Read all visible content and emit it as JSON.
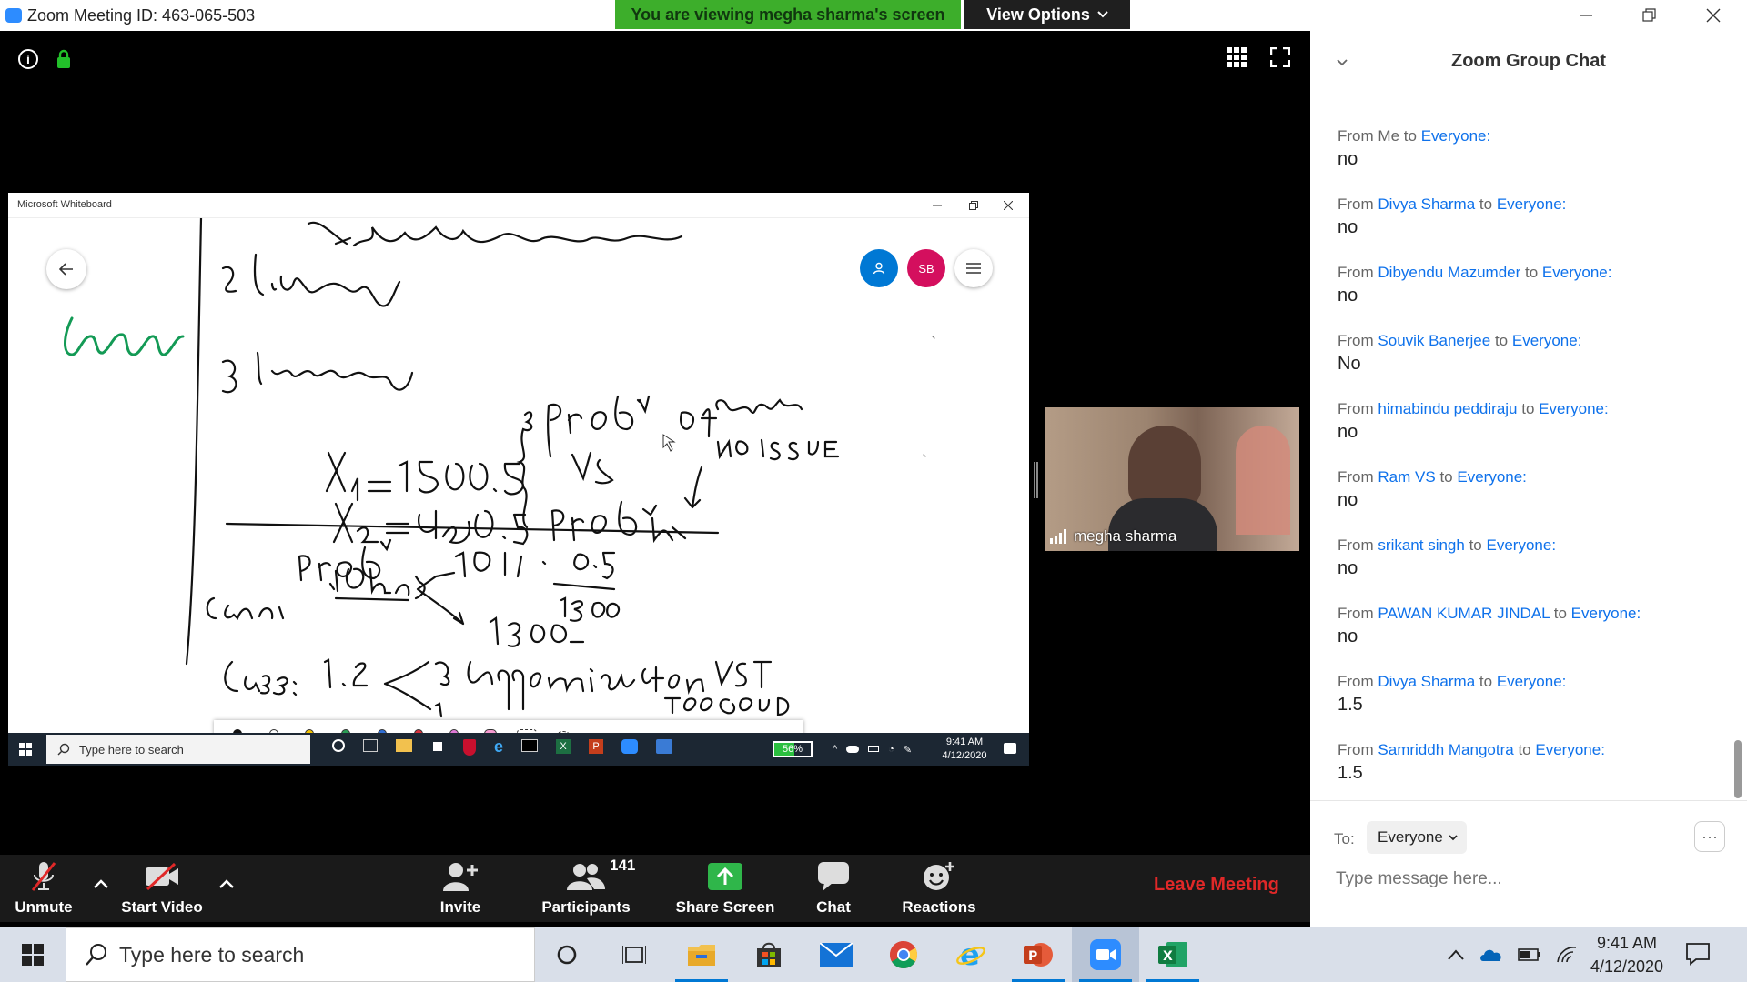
{
  "window": {
    "title": "Zoom Meeting ID: 463-065-503"
  },
  "banner": {
    "viewing_text": "You are viewing megha sharma's screen",
    "view_options_label": "View Options"
  },
  "whiteboard": {
    "title": "Microsoft Whiteboard",
    "user_initials": "SB",
    "taskbar": {
      "search_placeholder": "Type here to search",
      "battery": "56%",
      "time": "9:41 AM",
      "date": "4/12/2020"
    }
  },
  "video": {
    "participant_name": "megha sharma"
  },
  "toolbar": {
    "unmute_label": "Unmute",
    "start_video_label": "Start Video",
    "invite_label": "Invite",
    "participants_label": "Participants",
    "participants_count": "141",
    "share_screen_label": "Share Screen",
    "chat_label": "Chat",
    "reactions_label": "Reactions",
    "leave_label": "Leave Meeting"
  },
  "chat": {
    "title": "Zoom Group Chat",
    "messages": [
      {
        "from_prefix": "From",
        "sender": "Me",
        "to_word": "to",
        "recipient": "Everyone:",
        "text": "no"
      },
      {
        "from_prefix": "From",
        "sender": "Divya Sharma",
        "to_word": "to",
        "recipient": "Everyone:",
        "text": "no"
      },
      {
        "from_prefix": "From",
        "sender": "Dibyendu Mazumder",
        "to_word": "to",
        "recipient": "Everyone:",
        "text": "no"
      },
      {
        "from_prefix": "From",
        "sender": "Souvik Banerjee",
        "to_word": "to",
        "recipient": "Everyone:",
        "text": "No"
      },
      {
        "from_prefix": "From",
        "sender": "himabindu peddiraju",
        "to_word": "to",
        "recipient": "Everyone:",
        "text": "no"
      },
      {
        "from_prefix": "From",
        "sender": "Ram VS",
        "to_word": "to",
        "recipient": "Everyone:",
        "text": "no"
      },
      {
        "from_prefix": "From",
        "sender": "srikant singh",
        "to_word": "to",
        "recipient": "Everyone:",
        "text": "no"
      },
      {
        "from_prefix": "From",
        "sender": "PAWAN KUMAR JINDAL",
        "to_word": "to",
        "recipient": "Everyone:",
        "text": "no"
      },
      {
        "from_prefix": "From",
        "sender": "Divya Sharma",
        "to_word": "to",
        "recipient": "Everyone:",
        "text": "1.5"
      },
      {
        "from_prefix": "From",
        "sender": "Samriddh Mangotra",
        "to_word": "to",
        "recipient": "Everyone:",
        "text": "1.5"
      }
    ],
    "to_label": "To:",
    "to_value": "Everyone",
    "input_placeholder": "Type message here..."
  },
  "taskbar": {
    "search_placeholder": "Type here to search",
    "time": "9:41 AM",
    "date": "4/12/2020"
  },
  "colors": {
    "zoom_blue": "#2D8CFF",
    "banner_green": "#3DAE2B",
    "leave_red": "#E02828",
    "chat_link_blue": "#0E71EB"
  },
  "icons": [
    "zoom-app-icon",
    "info-icon",
    "lock-icon",
    "gallery-grid-icon",
    "fullscreen-icon",
    "microphone-muted-icon",
    "video-off-icon",
    "invite-icon",
    "participants-icon",
    "share-screen-icon",
    "chat-icon",
    "reactions-icon",
    "windows-start-icon",
    "search-icon",
    "cortana-icon",
    "task-view-icon",
    "file-explorer-icon",
    "store-icon",
    "mail-icon",
    "chrome-icon",
    "ie-icon",
    "powerpoint-icon",
    "zoom-icon",
    "excel-icon"
  ]
}
